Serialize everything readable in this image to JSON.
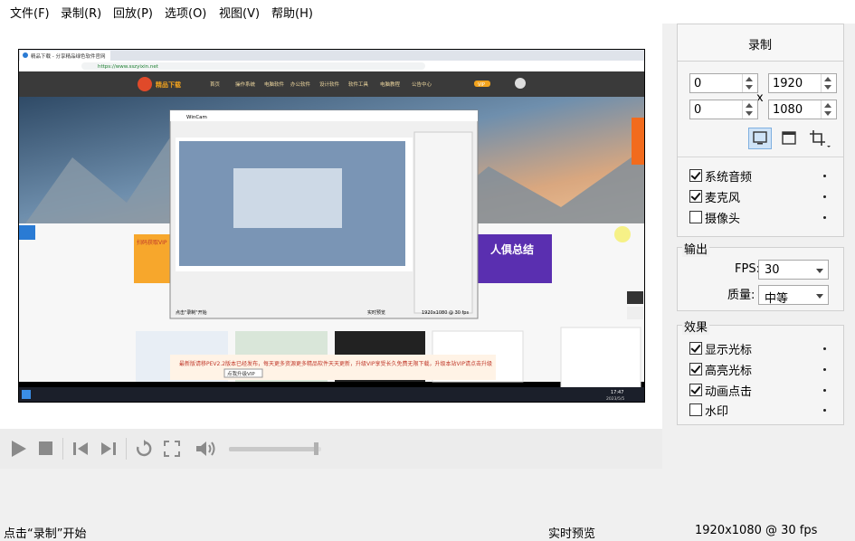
{
  "menu": [
    "文件(F)",
    "录制(R)",
    "回放(P)",
    "选项(O)",
    "视图(V)",
    "帮助(H)"
  ],
  "preview": {
    "browser_tab": "精品下载 - 分享精品绿色软件官网",
    "browser_url": "https://www.sszyixin.net",
    "site_nav": [
      "首页",
      "操作系统",
      "电脑软件",
      "办公软件",
      "设计软件",
      "软件工具",
      "电脑教程",
      "公告中心"
    ],
    "vip_label": "VIP",
    "notice": "最新版请移PEV2.2版本已经发布，每天更多资源更多精品软件天天更新，升级VIP享受长久免费无限下载，升级本站VIP请点击升级",
    "notice_button": "点我升级VIP",
    "inner_window_title": "WinCam",
    "inner_status_left": "点击\"录制\"开始",
    "inner_status_mid": "实时预览",
    "inner_status_right": "1920x1080 @ 30 fps",
    "taskbar_time": "17:47",
    "taskbar_date": "2023/5/5"
  },
  "controls": [
    "play-icon",
    "stop-icon",
    "skip-start-icon",
    "skip-end-icon",
    "loop-icon",
    "fullscreen-icon",
    "volume-icon"
  ],
  "volume_level": 0.95,
  "panel": {
    "record_button": "录制",
    "x": "0",
    "y": "0",
    "width": "1920",
    "height": "1080",
    "size_sep": "x",
    "capture_modes": [
      "fullscreen-mode-icon",
      "window-mode-icon",
      "region-crop-icon"
    ],
    "audio": [
      {
        "label": "系统音频",
        "checked": true
      },
      {
        "label": "麦克风",
        "checked": true
      },
      {
        "label": "摄像头",
        "checked": false
      }
    ],
    "output": {
      "title": "输出",
      "fps_label": "FPS:",
      "fps_value": "30",
      "quality_label": "质量:",
      "quality_value": "中等"
    },
    "effects": {
      "title": "效果",
      "items": [
        {
          "label": "显示光标",
          "checked": true
        },
        {
          "label": "高亮光标",
          "checked": true
        },
        {
          "label": "动画点击",
          "checked": true
        },
        {
          "label": "水印",
          "checked": false
        }
      ]
    }
  },
  "status": {
    "left": "点击“录制”开始",
    "middle": "实时预览",
    "right": "1920x1080 @ 30 fps"
  }
}
